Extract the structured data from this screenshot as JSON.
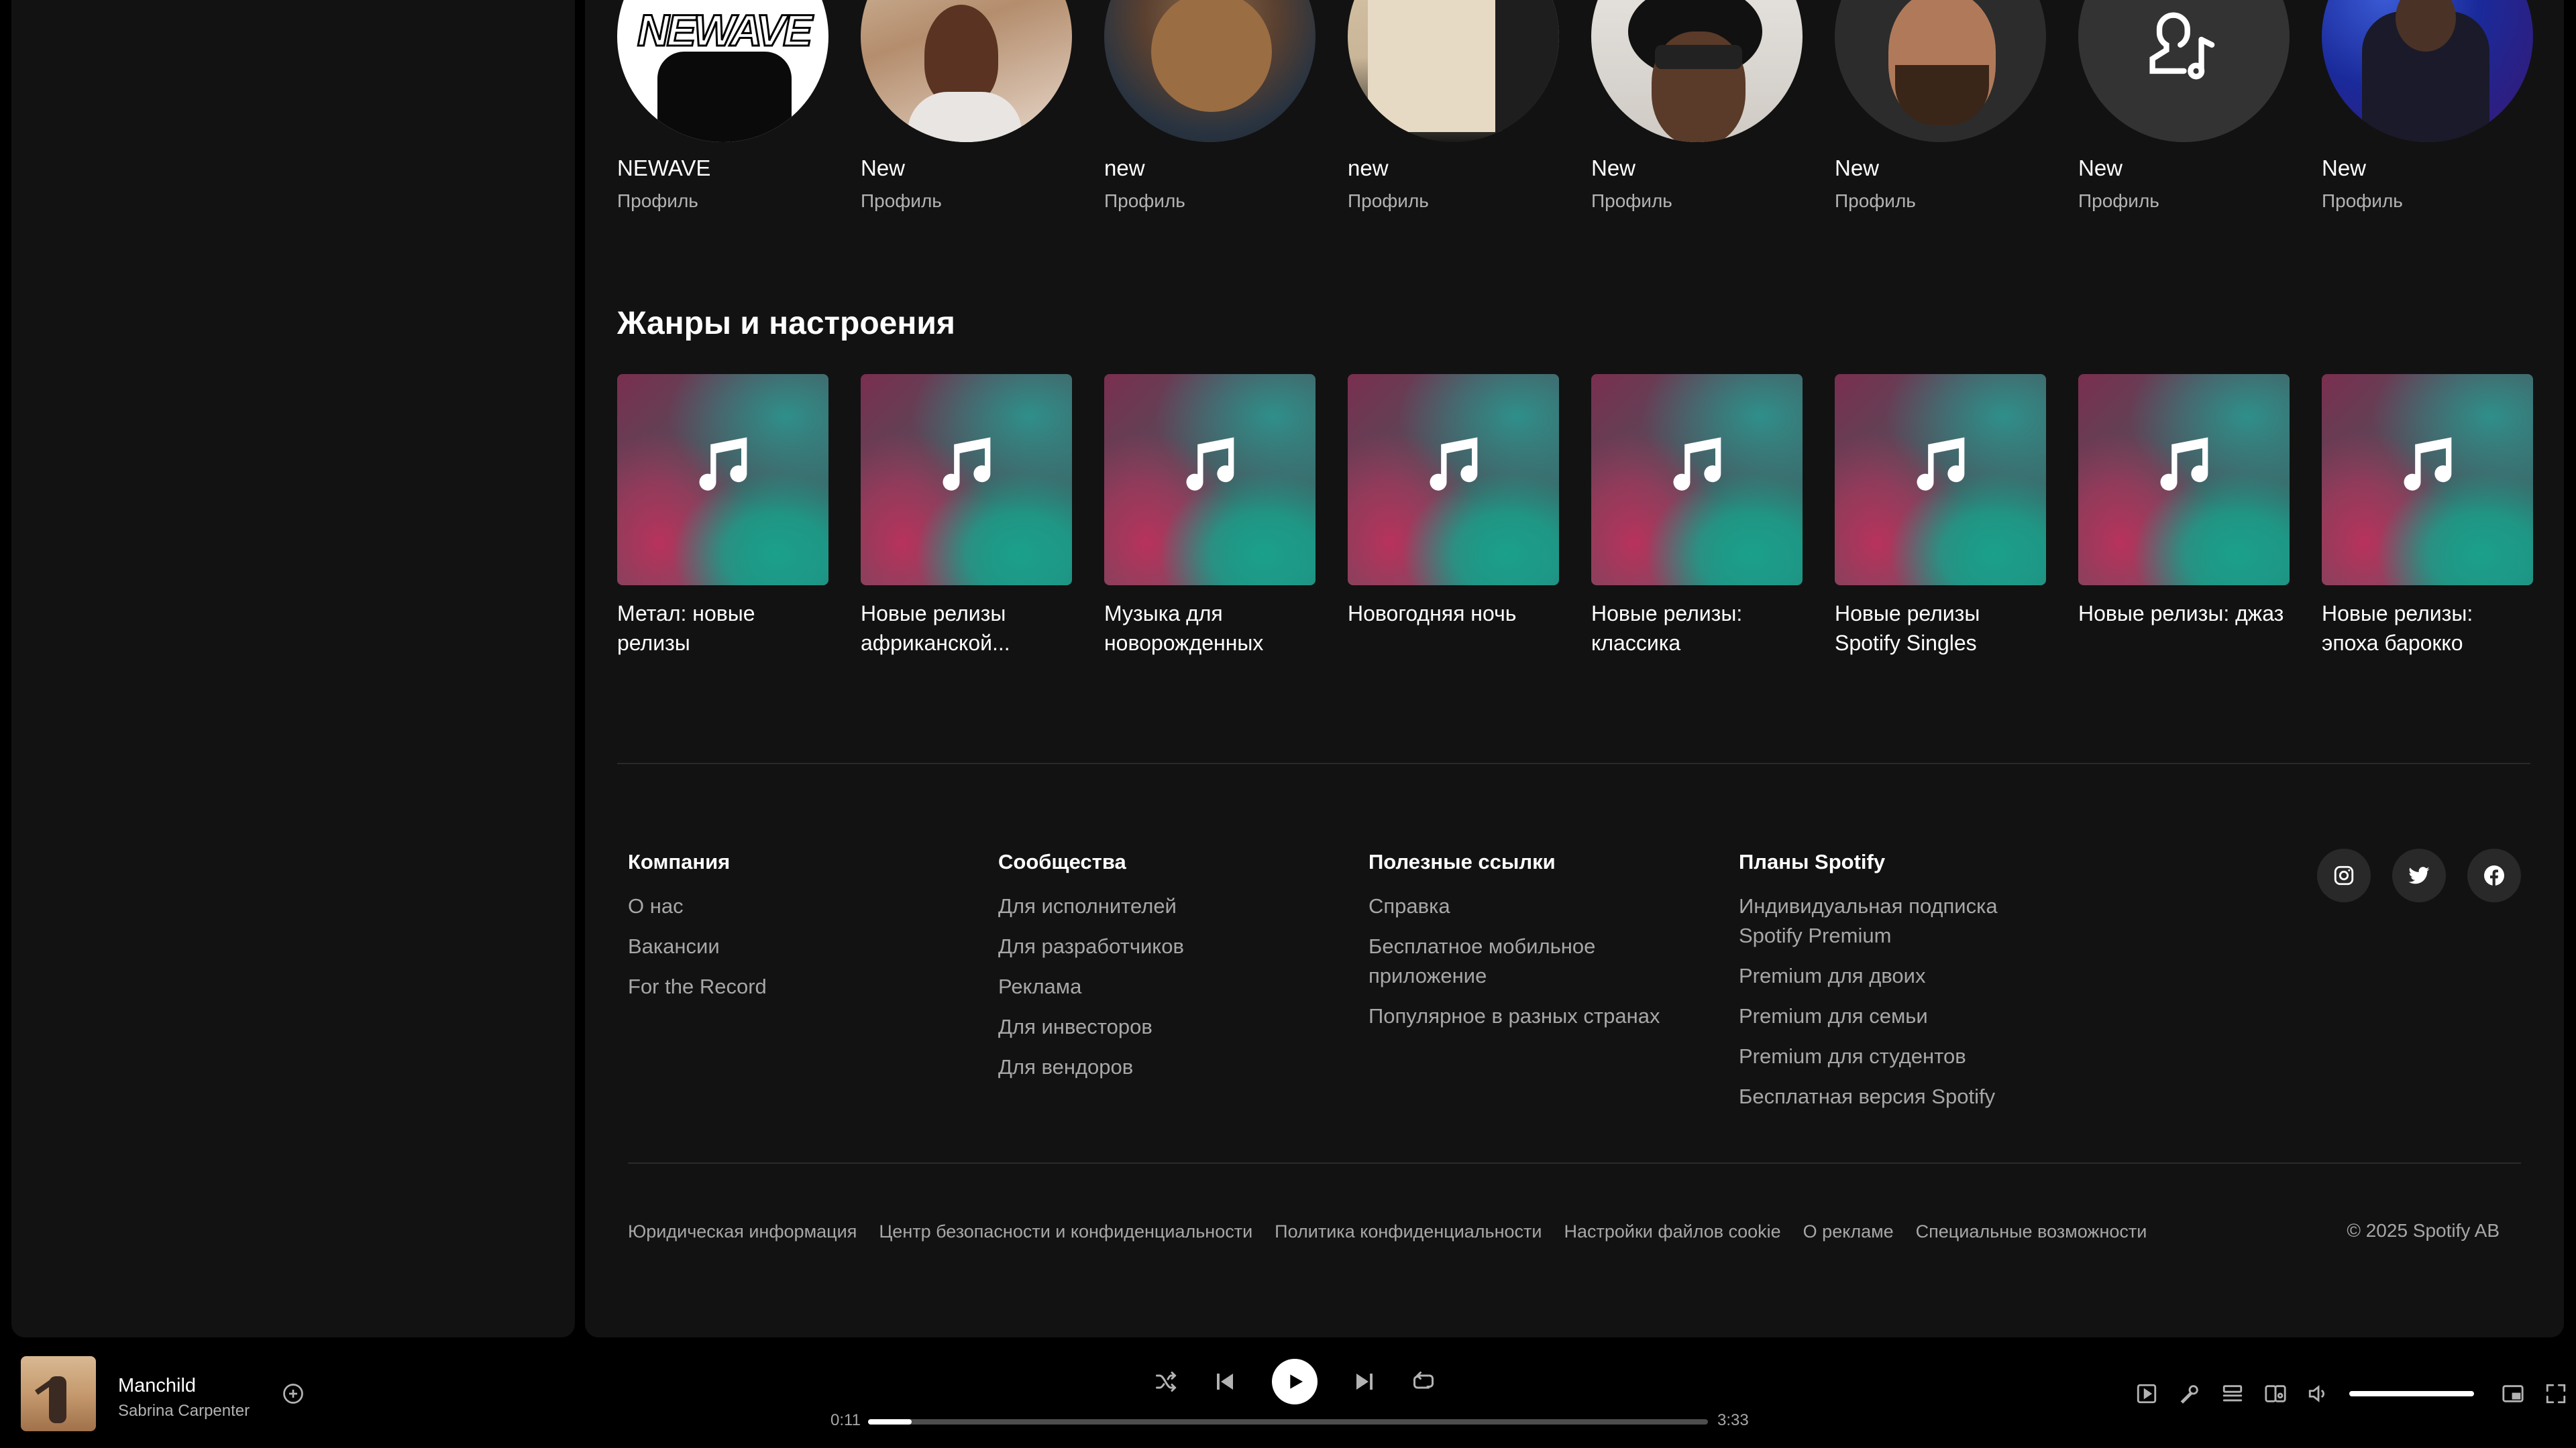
{
  "profiles": [
    {
      "name": "NEWAVE",
      "type": "Профиль",
      "logo_text": "NEWAVE"
    },
    {
      "name": "New",
      "type": "Профиль"
    },
    {
      "name": "new",
      "type": "Профиль"
    },
    {
      "name": "new",
      "type": "Профиль"
    },
    {
      "name": "New",
      "type": "Профиль"
    },
    {
      "name": "New",
      "type": "Профиль"
    },
    {
      "name": "New",
      "type": "Профиль",
      "icon": "user-music-icon"
    },
    {
      "name": "New",
      "type": "Профиль"
    }
  ],
  "genres_section": {
    "title": "Жанры и настроения",
    "items": [
      {
        "title": "Метал: новые релизы"
      },
      {
        "title": "Новые релизы африканской..."
      },
      {
        "title": "Музыка для новорожденных"
      },
      {
        "title": "Новогодняя ночь"
      },
      {
        "title": "Новые релизы: классика"
      },
      {
        "title": "Новые релизы Spotify Singles"
      },
      {
        "title": "Новые релизы: джаз"
      },
      {
        "title": "Новые релизы: эпоха барокко"
      }
    ],
    "icon": "music-note-icon"
  },
  "footer": {
    "columns": [
      {
        "heading": "Компания",
        "links": [
          "О нас",
          "Вакансии",
          "For the Record"
        ]
      },
      {
        "heading": "Сообщества",
        "links": [
          "Для исполнителей",
          "Для разработчиков",
          "Реклама",
          "Для инвесторов",
          "Для вендоров"
        ]
      },
      {
        "heading": "Полезные ссылки",
        "links": [
          "Справка",
          "Бесплатное мобильное приложение",
          "Популярное в разных странах"
        ]
      },
      {
        "heading": "Планы Spotify",
        "links": [
          "Индивидуальная подписка Spotify Premium",
          "Premium для двоих",
          "Premium для семьи",
          "Premium для студентов",
          "Бесплатная версия Spotify"
        ]
      }
    ],
    "socials": [
      "instagram-icon",
      "twitter-icon",
      "facebook-icon"
    ],
    "legal_links": [
      "Юридическая информация",
      "Центр безопасности и конфиденциальности",
      "Политика конфиденциальности",
      "Настройки файлов cookie",
      "О рекламе",
      "Специальные возможности"
    ],
    "copyright": "© 2025 Spotify AB"
  },
  "player": {
    "track_title": "Manchild",
    "artist": "Sabrina Carpenter",
    "elapsed": "0:11",
    "duration": "3:33",
    "progress_fraction": 0.052,
    "volume_fraction": 1.0,
    "colors": {
      "accent": "#ffffff",
      "track_bg": "#4d4d4d",
      "text_muted": "#a7a7a7"
    }
  }
}
